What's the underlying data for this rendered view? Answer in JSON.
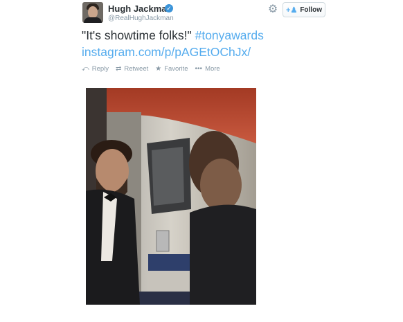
{
  "user": {
    "fullname": "Hugh Jackman",
    "username": "@RealHughJackman",
    "verified": true
  },
  "header": {
    "follow_label": "Follow"
  },
  "tweet": {
    "text": "\"It's showtime folks!\"",
    "hashtag": "#tonyawards",
    "link": "instagram.com/p/pAGEtOChJx/"
  },
  "actions": {
    "reply": "Reply",
    "retweet": "Retweet",
    "favorite": "Favorite",
    "more": "More"
  },
  "colors": {
    "link": "#55acee",
    "text": "#292f33",
    "muted": "#8899a6",
    "verified": "#3b94d9"
  },
  "icons": {
    "gear": "gear-icon",
    "follow": "person-add-icon",
    "reply": "reply-icon",
    "retweet": "retweet-icon",
    "favorite": "star-icon",
    "more": "ellipsis-icon"
  }
}
